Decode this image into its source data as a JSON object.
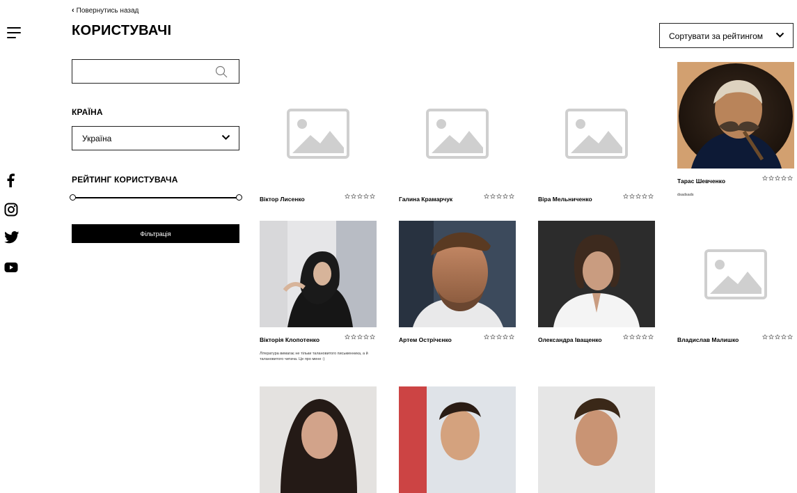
{
  "nav": {
    "back_label": "Повернутись назад",
    "title": "КОРИСТУВАЧІ",
    "menu_icon": "hamburger-menu-icon"
  },
  "social": [
    "facebook-icon",
    "instagram-icon",
    "twitter-icon",
    "youtube-icon"
  ],
  "filters": {
    "search_value": "",
    "country_label": "КРАЇНА",
    "country_value": "Україна",
    "rating_label": "РЕЙТИНГ КОРИСТУВАЧА",
    "rating_range": [
      0,
      5
    ],
    "filter_button": "Фільтрація"
  },
  "sort": {
    "value": "Сортувати за рейтингом"
  },
  "users": [
    {
      "name": "Віктор Лисенко",
      "rating": 0,
      "photo": "placeholder",
      "bio": ""
    },
    {
      "name": "Галина Крамарчук",
      "rating": 0,
      "photo": "placeholder",
      "bio": ""
    },
    {
      "name": "Віра Мельниченко",
      "rating": 0,
      "photo": "placeholder",
      "bio": ""
    },
    {
      "name": "Тарас Шевченко",
      "rating": 0,
      "photo": "portrait",
      "bio": "dsadsads"
    },
    {
      "name": "Вікторія Клопотенко",
      "rating": 0,
      "photo": "portrait",
      "bio": "Література вимагає не тільки талановитого письменника, а й талановитого читача. Це про мене :)"
    },
    {
      "name": "Артем Острічєнко",
      "rating": 0,
      "photo": "portrait",
      "bio": ""
    },
    {
      "name": "Олександра Іващенко",
      "rating": 0,
      "photo": "portrait",
      "bio": ""
    },
    {
      "name": "Владислав Малишко",
      "rating": 0,
      "photo": "placeholder",
      "bio": ""
    },
    {
      "name": "",
      "rating": 0,
      "photo": "portrait",
      "bio": ""
    },
    {
      "name": "",
      "rating": 0,
      "photo": "portrait",
      "bio": ""
    },
    {
      "name": "",
      "rating": 0,
      "photo": "portrait",
      "bio": ""
    }
  ]
}
